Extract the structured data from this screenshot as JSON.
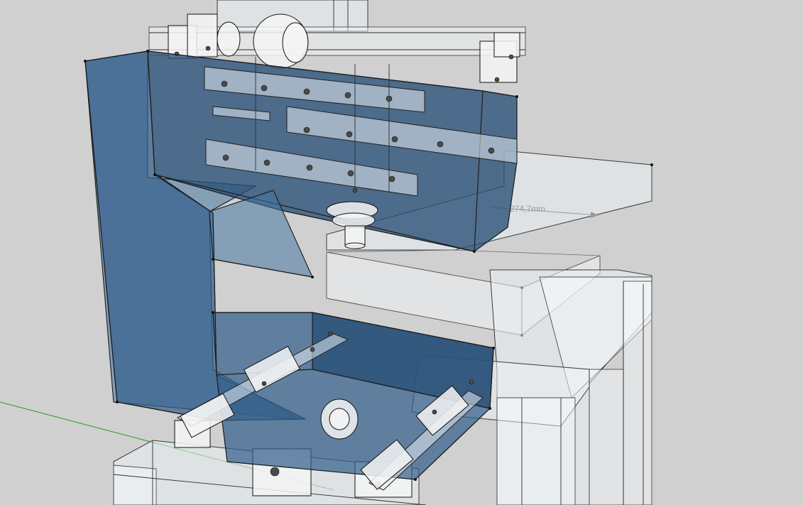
{
  "viewer": {
    "background_color": "#d0d0d0",
    "model_body_color": "#34608c",
    "axis_green_color": "#2fa32f"
  },
  "scene": {
    "dimension_label": "274,7mm"
  }
}
